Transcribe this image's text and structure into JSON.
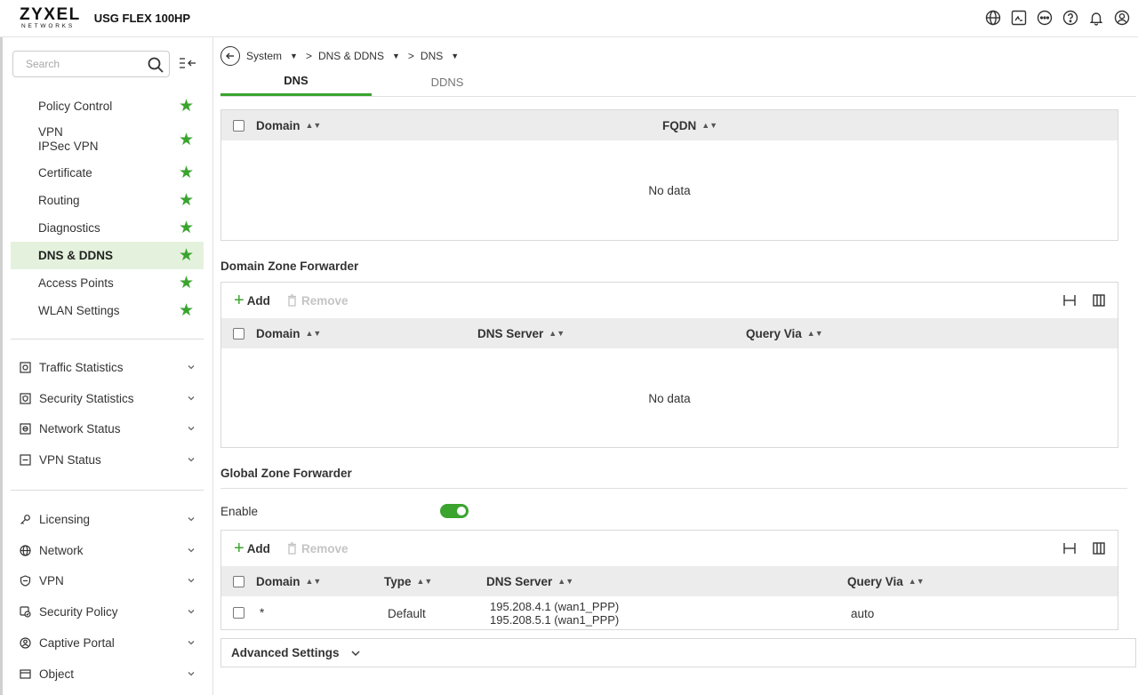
{
  "header": {
    "logo_main": "ZYXEL",
    "logo_sub": "NETWORKS",
    "model": "USG FLEX 100HP",
    "icons": [
      "globe-icon",
      "terminal-icon",
      "more-icon",
      "help-icon",
      "bell-icon",
      "user-icon"
    ]
  },
  "sidebar": {
    "search_placeholder": "Search",
    "favorites": [
      {
        "label": "Policy Control"
      },
      {
        "label": "VPN",
        "label2": "IPSec VPN"
      },
      {
        "label": "Certificate"
      },
      {
        "label": "Routing"
      },
      {
        "label": "Diagnostics"
      },
      {
        "label": "DNS & DDNS",
        "active": true
      },
      {
        "label": "Access Points"
      },
      {
        "label": "WLAN Settings"
      }
    ],
    "monitor": [
      {
        "label": "Traffic Statistics",
        "icon": "traffic-stats-icon"
      },
      {
        "label": "Security Statistics",
        "icon": "security-stats-icon"
      },
      {
        "label": "Network Status",
        "icon": "network-status-icon"
      },
      {
        "label": "VPN Status",
        "icon": "vpn-status-icon"
      }
    ],
    "config": [
      {
        "label": "Licensing",
        "icon": "key-icon"
      },
      {
        "label": "Network",
        "icon": "globe-icon"
      },
      {
        "label": "VPN",
        "icon": "shield-icon"
      },
      {
        "label": "Security Policy",
        "icon": "security-policy-icon"
      },
      {
        "label": "Captive Portal",
        "icon": "captive-portal-icon"
      },
      {
        "label": "Object",
        "icon": "object-icon"
      }
    ]
  },
  "breadcrumb": {
    "items": [
      "System",
      "DNS & DDNS",
      "DNS"
    ],
    "separator": ">"
  },
  "tabs": [
    {
      "label": "DNS",
      "active": true
    },
    {
      "label": "DDNS",
      "active": false
    }
  ],
  "table1": {
    "columns": [
      "Domain",
      "FQDN"
    ],
    "empty_text": "No data"
  },
  "domain_zone": {
    "title": "Domain Zone Forwarder",
    "add_label": "Add",
    "remove_label": "Remove",
    "columns": [
      "Domain",
      "DNS Server",
      "Query Via"
    ],
    "empty_text": "No data"
  },
  "global_zone": {
    "title": "Global Zone Forwarder",
    "enable_label": "Enable",
    "enabled": true,
    "add_label": "Add",
    "remove_label": "Remove",
    "columns": [
      "Domain",
      "Type",
      "DNS Server",
      "Query Via"
    ],
    "rows": [
      {
        "domain": "*",
        "type": "Default",
        "dns1": "195.208.4.1 (wan1_PPP)",
        "dns2": "195.208.5.1 (wan1_PPP)",
        "query_via": "auto"
      }
    ]
  },
  "advanced": {
    "label": "Advanced Settings"
  },
  "colors": {
    "accent": "#3aa42e",
    "active_bg": "#e4f2dd",
    "table_head": "#ececec"
  }
}
